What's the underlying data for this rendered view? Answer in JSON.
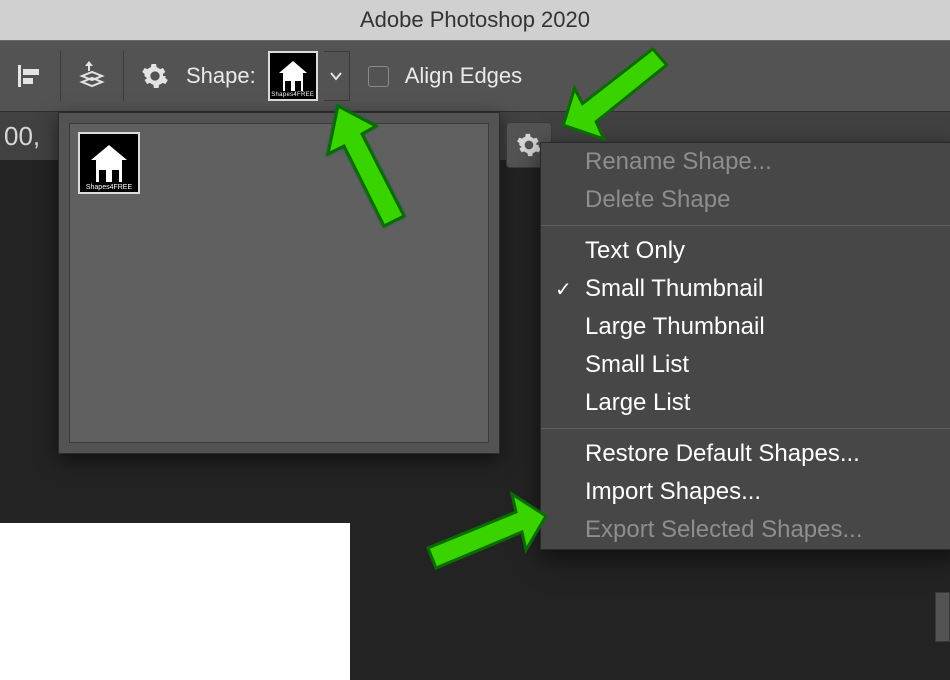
{
  "app": {
    "title": "Adobe Photoshop 2020"
  },
  "optionsbar": {
    "shape_label": "Shape:",
    "shape_thumb_caption": "Shapes4FREE",
    "align_edges_label": "Align Edges"
  },
  "tabarea": {
    "fragment": "00,"
  },
  "shape_picker": {
    "thumb_caption": "Shapes4FREE"
  },
  "context_menu": {
    "rename": "Rename Shape...",
    "delete": "Delete Shape",
    "text_only": "Text Only",
    "small_thumb": "Small Thumbnail",
    "large_thumb": "Large Thumbnail",
    "small_list": "Small List",
    "large_list": "Large List",
    "restore": "Restore Default Shapes...",
    "import": "Import Shapes...",
    "export": "Export Selected Shapes...",
    "selected_view": "small_thumb"
  },
  "colors": {
    "annotation_arrow": "#39d400"
  }
}
